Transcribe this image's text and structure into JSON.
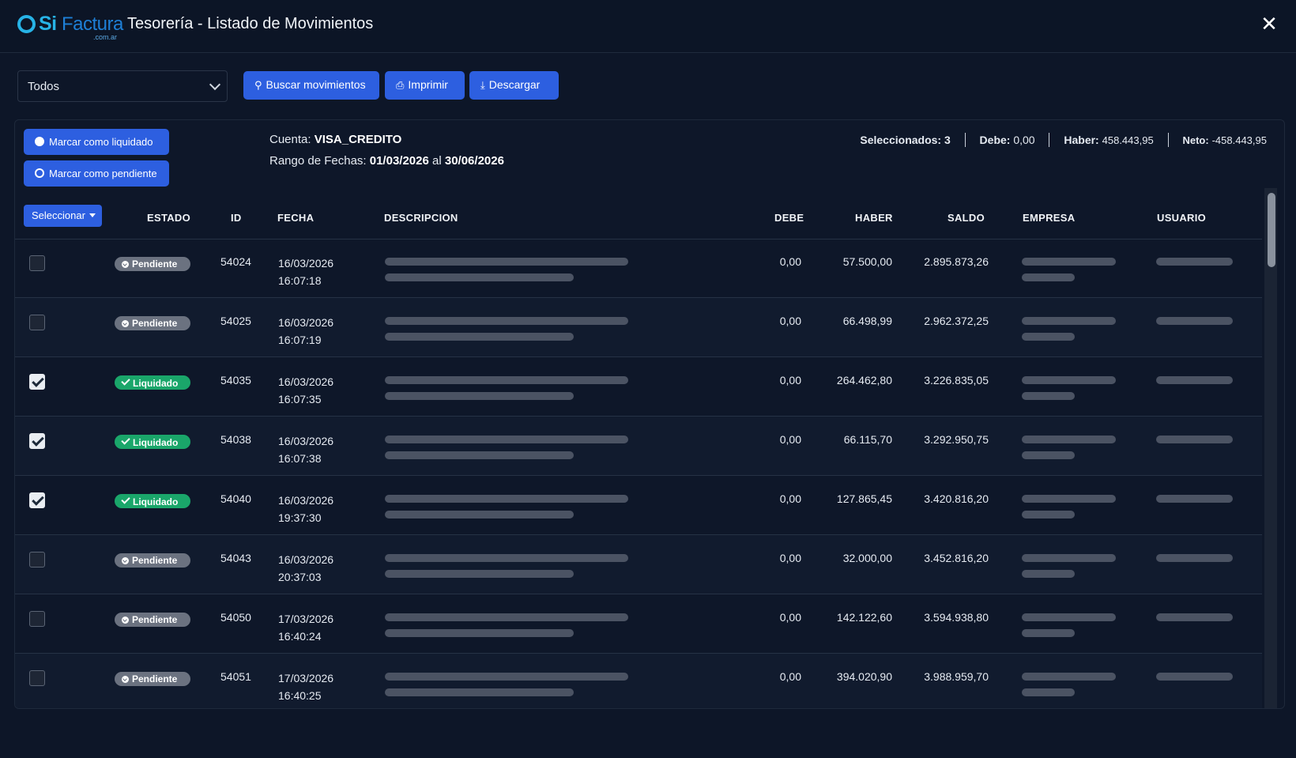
{
  "app": {
    "logo_si": "Si",
    "logo_factura": "Factura",
    "logo_domain": ".com.ar",
    "title": "Tesorería - Listado de Movimientos",
    "close_icon": "close-icon"
  },
  "toolbar": {
    "filter_value": "Todos",
    "search_label": "Buscar movimientos",
    "print_label": "Imprimir",
    "download_label": "Descargar"
  },
  "actions": {
    "mark_settled": "Marcar como liquidado",
    "mark_pending": "Marcar como pendiente"
  },
  "info": {
    "cuenta_label": "Cuenta:",
    "cuenta_value": "VISA_CREDITO",
    "rango_label": "Rango de Fechas:",
    "rango_from": "01/03/2026",
    "rango_sep": "al",
    "rango_to": "30/06/2026"
  },
  "summary": {
    "sel_label": "Seleccionados:",
    "sel_value": "3",
    "debe_label": "Debe:",
    "debe_value": "0,00",
    "haber_label": "Haber:",
    "haber_value": "458.443,95",
    "neto_label": "Neto:",
    "neto_value": "-458.443,95"
  },
  "table": {
    "select_label": "Seleccionar",
    "columns": {
      "estado": "ESTADO",
      "id": "ID",
      "fecha": "FECHA",
      "descripcion": "DESCRIPCION",
      "debe": "DEBE",
      "haber": "HABER",
      "saldo": "SALDO",
      "empresa": "EMPRESA",
      "usuario": "USUARIO"
    },
    "rows": [
      {
        "checked": false,
        "estado": "Pendiente",
        "id": "54024",
        "fecha": "16/03/2026",
        "hora": "16:07:18",
        "debe": "0,00",
        "haber": "57.500,00",
        "saldo": "2.895.873,26"
      },
      {
        "checked": false,
        "estado": "Pendiente",
        "id": "54025",
        "fecha": "16/03/2026",
        "hora": "16:07:19",
        "debe": "0,00",
        "haber": "66.498,99",
        "saldo": "2.962.372,25"
      },
      {
        "checked": true,
        "estado": "Liquidado",
        "id": "54035",
        "fecha": "16/03/2026",
        "hora": "16:07:35",
        "debe": "0,00",
        "haber": "264.462,80",
        "saldo": "3.226.835,05"
      },
      {
        "checked": true,
        "estado": "Liquidado",
        "id": "54038",
        "fecha": "16/03/2026",
        "hora": "16:07:38",
        "debe": "0,00",
        "haber": "66.115,70",
        "saldo": "3.292.950,75"
      },
      {
        "checked": true,
        "estado": "Liquidado",
        "id": "54040",
        "fecha": "16/03/2026",
        "hora": "19:37:30",
        "debe": "0,00",
        "haber": "127.865,45",
        "saldo": "3.420.816,20"
      },
      {
        "checked": false,
        "estado": "Pendiente",
        "id": "54043",
        "fecha": "16/03/2026",
        "hora": "20:37:03",
        "debe": "0,00",
        "haber": "32.000,00",
        "saldo": "3.452.816,20"
      },
      {
        "checked": false,
        "estado": "Pendiente",
        "id": "54050",
        "fecha": "17/03/2026",
        "hora": "16:40:24",
        "debe": "0,00",
        "haber": "142.122,60",
        "saldo": "3.594.938,80"
      },
      {
        "checked": false,
        "estado": "Pendiente",
        "id": "54051",
        "fecha": "17/03/2026",
        "hora": "16:40:25",
        "debe": "0,00",
        "haber": "394.020,90",
        "saldo": "3.988.959,70"
      }
    ]
  },
  "colors": {
    "accent": "#2d5fe0",
    "pending": "#6b7280",
    "settled": "#1aa66a",
    "background": "#0d1628"
  }
}
